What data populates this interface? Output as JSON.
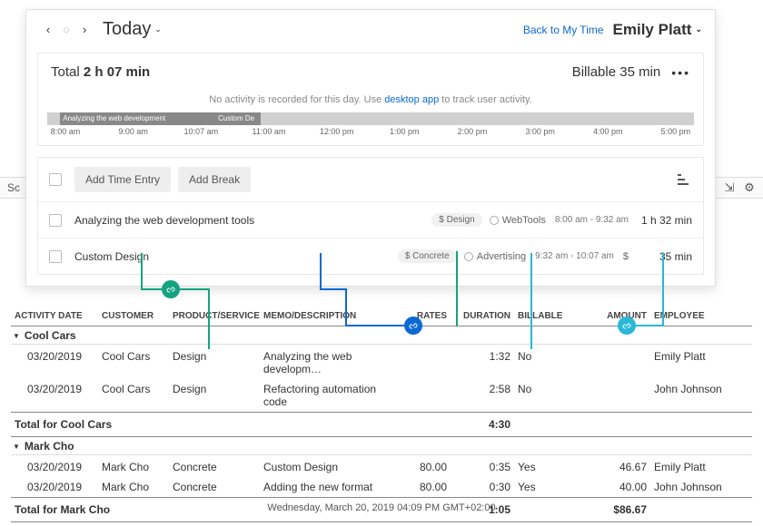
{
  "header": {
    "today_label": "Today",
    "back_link": "Back to My Time",
    "username": "Emily Platt"
  },
  "bg_strip": {
    "left": "Sc"
  },
  "totals": {
    "total_prefix": "Total",
    "total_value": "2 h 07 min",
    "billable_prefix": "Billable",
    "billable_value": "35 min"
  },
  "no_activity": {
    "pre": "No activity is recorded for this day. Use ",
    "link": "desktop app",
    "post": " to track user activity."
  },
  "timeline": {
    "seg1": "Analyzing the web development",
    "seg2": "Custom De",
    "ticks": [
      "8:00 am",
      "9:00 am",
      "10:07 am",
      "11:00 am",
      "12:00 pm",
      "1:00 pm",
      "2:00 pm",
      "3:00 pm",
      "4:00 pm",
      "5:00 pm"
    ]
  },
  "buttons": {
    "add_time": "Add Time Entry",
    "add_break": "Add Break"
  },
  "entries": [
    {
      "desc": "Analyzing the web development tools",
      "tag": "$ Design",
      "project": "WebTools",
      "range": "8:00 am - 9:32 am",
      "show_dollar": false,
      "duration": "1 h 32 min"
    },
    {
      "desc": "Custom Design",
      "tag": "$ Concrete",
      "project": "Advertising",
      "range": "9:32 am - 10:07 am",
      "show_dollar": true,
      "duration": "35 min"
    }
  ],
  "columns": {
    "date": "ACTIVITY DATE",
    "customer": "CUSTOMER",
    "product": "PRODUCT/SERVICE",
    "memo": "MEMO/DESCRIPTION",
    "rates": "RATES",
    "duration": "DURATION",
    "billable": "BILLABLE",
    "amount": "AMOUNT",
    "employee": "EMPLOYEE"
  },
  "groups": [
    {
      "name": "Cool Cars",
      "rows": [
        {
          "date": "03/20/2019",
          "customer": "Cool Cars",
          "product": "Design",
          "memo": "Analyzing the web developm…",
          "rates": "",
          "duration": "1:32",
          "billable": "No",
          "amount": "",
          "employee": "Emily Platt"
        },
        {
          "date": "03/20/2019",
          "customer": "Cool Cars",
          "product": "Design",
          "memo": "Refactoring automation code",
          "rates": "",
          "duration": "2:58",
          "billable": "No",
          "amount": "",
          "employee": "John Johnson"
        }
      ],
      "total_label": "Total for Cool Cars",
      "total_duration": "4:30",
      "total_amount": ""
    },
    {
      "name": "Mark Cho",
      "rows": [
        {
          "date": "03/20/2019",
          "customer": "Mark Cho",
          "product": "Concrete",
          "memo": "Custom Design",
          "rates": "80.00",
          "duration": "0:35",
          "billable": "Yes",
          "amount": "46.67",
          "employee": "Emily Platt"
        },
        {
          "date": "03/20/2019",
          "customer": "Mark Cho",
          "product": "Concrete",
          "memo": "Adding the new format",
          "rates": "80.00",
          "duration": "0:30",
          "billable": "Yes",
          "amount": "40.00",
          "employee": "John Johnson"
        }
      ],
      "total_label": "Total for Mark Cho",
      "total_duration": "1:05",
      "total_amount": "$86.67"
    }
  ],
  "footer": "Wednesday, March 20, 2019   04:09 PM GMT+02:00"
}
